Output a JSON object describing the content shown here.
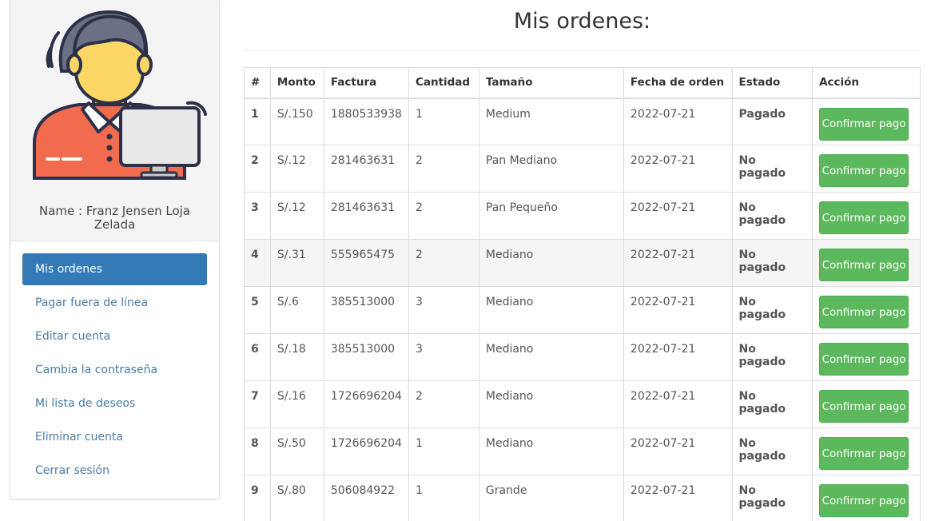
{
  "profile": {
    "name_line": "Name : Franz Jensen Loja Zelada"
  },
  "menu": {
    "items": [
      {
        "label": "Mis ordenes",
        "active": true
      },
      {
        "label": "Pagar fuera de línea"
      },
      {
        "label": "Editar cuenta"
      },
      {
        "label": "Cambia la contraseña"
      },
      {
        "label": "Mi lista de deseos"
      },
      {
        "label": "Eliminar cuenta"
      },
      {
        "label": "Cerrar sesión"
      }
    ]
  },
  "main": {
    "title": "Mis ordenes:",
    "columns": [
      "#",
      "Monto",
      "Factura",
      "Cantidad",
      "Tamaño",
      "Fecha de orden",
      "Estado",
      "Acción"
    ],
    "rows": [
      {
        "num": "1",
        "monto": "S/.150",
        "factura": "1880533938",
        "cantidad": "1",
        "tamano": "Medium",
        "fecha": "2022-07-21",
        "estado": "Pagado",
        "accion": "Confirmar pago"
      },
      {
        "num": "2",
        "monto": "S/.12",
        "factura": "281463631",
        "cantidad": "2",
        "tamano": "Pan Mediano",
        "fecha": "2022-07-21",
        "estado": "No pagado",
        "accion": "Confirmar pago"
      },
      {
        "num": "3",
        "monto": "S/.12",
        "factura": "281463631",
        "cantidad": "2",
        "tamano": "Pan Pequeño",
        "fecha": "2022-07-21",
        "estado": "No pagado",
        "accion": "Confirmar pago"
      },
      {
        "num": "4",
        "monto": "S/.31",
        "factura": "555965475",
        "cantidad": "2",
        "tamano": "Mediano",
        "fecha": "2022-07-21",
        "estado": "No pagado",
        "accion": "Confirmar pago"
      },
      {
        "num": "5",
        "monto": "S/.6",
        "factura": "385513000",
        "cantidad": "3",
        "tamano": "Mediano",
        "fecha": "2022-07-21",
        "estado": "No pagado",
        "accion": "Confirmar pago"
      },
      {
        "num": "6",
        "monto": "S/.18",
        "factura": "385513000",
        "cantidad": "3",
        "tamano": "Mediano",
        "fecha": "2022-07-21",
        "estado": "No pagado",
        "accion": "Confirmar pago"
      },
      {
        "num": "7",
        "monto": "S/.16",
        "factura": "1726696204",
        "cantidad": "2",
        "tamano": "Mediano",
        "fecha": "2022-07-21",
        "estado": "No pagado",
        "accion": "Confirmar pago"
      },
      {
        "num": "8",
        "monto": "S/.50",
        "factura": "1726696204",
        "cantidad": "1",
        "tamano": "Mediano",
        "fecha": "2022-07-21",
        "estado": "No pagado",
        "accion": "Confirmar pago"
      },
      {
        "num": "9",
        "monto": "S/.80",
        "factura": "506084922",
        "cantidad": "1",
        "tamano": "Grande",
        "fecha": "2022-07-21",
        "estado": "No pagado",
        "accion": "Confirmar pago"
      }
    ]
  },
  "colors": {
    "active_menu": "#337ab7",
    "menu_link": "#4a7ba7",
    "paid": "#2e8b2e",
    "unpaid": "#ee0000",
    "button": "#5cb85c"
  }
}
